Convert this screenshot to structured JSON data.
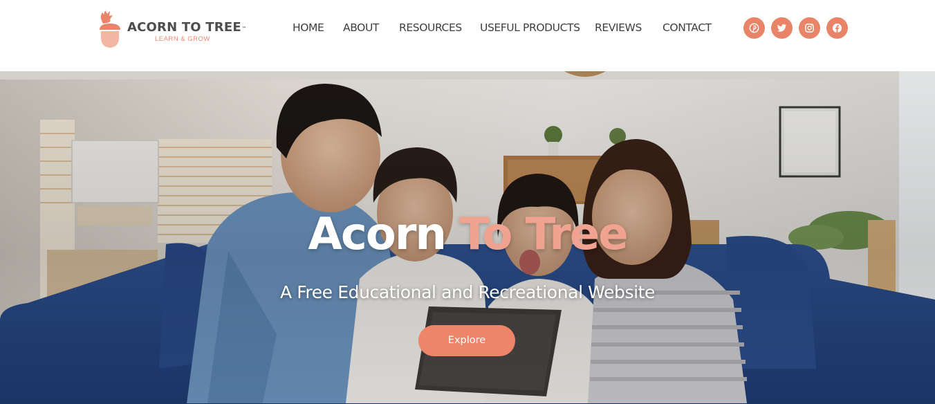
{
  "brand": {
    "name": "ACORN TO TREE",
    "trademark": "™",
    "tagline": "LEARN & GROW"
  },
  "nav": {
    "items": [
      {
        "label": "HOME"
      },
      {
        "label": "ABOUT"
      },
      {
        "label": "RESOURCES"
      },
      {
        "label": "USEFUL PRODUCTS"
      },
      {
        "label": "REVIEWS"
      },
      {
        "label": "CONTACT"
      }
    ]
  },
  "social": [
    {
      "icon": "pinterest-icon"
    },
    {
      "icon": "twitter-icon"
    },
    {
      "icon": "instagram-icon"
    },
    {
      "icon": "facebook-icon"
    }
  ],
  "hero": {
    "title_part1": "Acorn ",
    "title_part2": "To Tree",
    "subtitle": "A Free Educational and Recreational Website",
    "cta_label": "Explore",
    "image": "family-on-sofa-with-tablet-photo"
  },
  "colors": {
    "accent": "#EA8469",
    "nav_text": "#3E3E3E",
    "logo_text": "#4D4D4D",
    "title_highlight": "#F0A390"
  }
}
